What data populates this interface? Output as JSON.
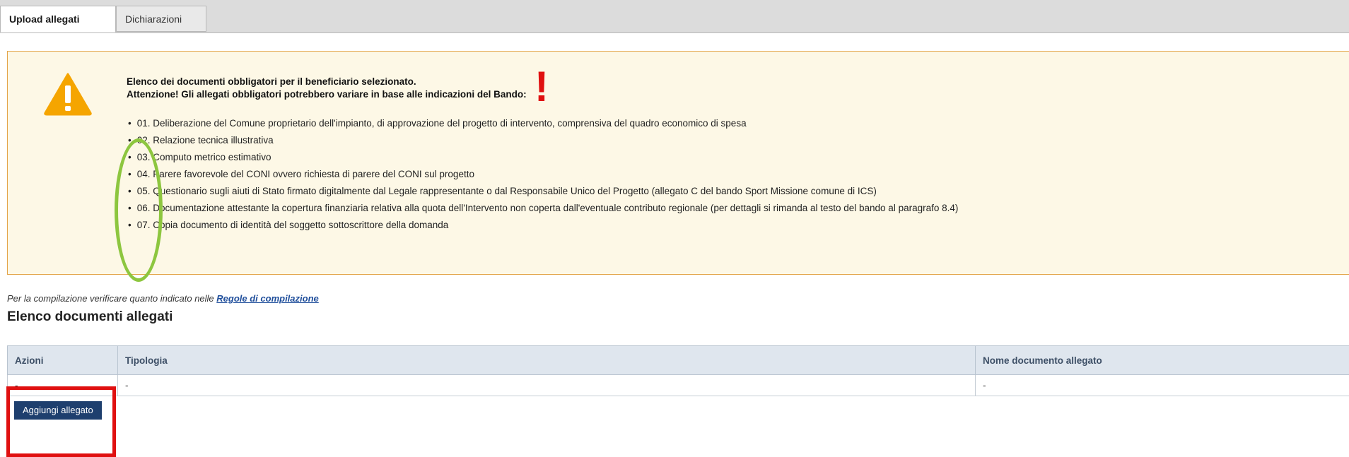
{
  "tabs": [
    {
      "label": "Upload allegati",
      "active": true
    },
    {
      "label": "Dichiarazioni",
      "active": false
    }
  ],
  "warning": {
    "line1": "Elenco dei documenti obbligatori per il beneficiario selezionato.",
    "line2": "Attenzione! Gli allegati obbligatori potrebbero variare in base alle indicazioni del Bando:",
    "items": [
      "01. Deliberazione del Comune proprietario dell'impianto, di approvazione del progetto di intervento, comprensiva del quadro economico di spesa",
      "02. Relazione tecnica illustrativa",
      "03. Computo metrico estimativo",
      "04. Parere favorevole del CONI ovvero richiesta di parere del CONI sul progetto",
      "05. Questionario sugli aiuti di Stato firmato digitalmente dal Legale rappresentante o dal Responsabile Unico del Progetto (allegato C del bando Sport Missione comune di ICS)",
      "06. Documentazione attestante la copertura finanziaria relativa alla quota dell'Intervento non coperta dall'eventuale contributo regionale (per dettagli si rimanda al testo del bando al paragrafo 8.4)",
      "07. Copia documento di identità del soggetto sottoscrittore della domanda"
    ],
    "annotation_mark": "!",
    "icon": "warning-triangle-icon",
    "colors": {
      "border": "#e3a54a",
      "background": "#fdf8e6",
      "icon": "#f5a500"
    }
  },
  "rules": {
    "text": "Per la compilazione verificare quanto indicato nelle ",
    "link": "Regole di compilazione"
  },
  "section_title": "Elenco documenti allegati",
  "table": {
    "headers": [
      "Azioni",
      "Tipologia",
      "Nome documento allegato"
    ],
    "rows": [
      [
        "-",
        "-",
        "-"
      ]
    ]
  },
  "add_button": "Aggiungi allegato",
  "annotation_colors": {
    "red": "#e01010",
    "green": "#8dc63f"
  }
}
